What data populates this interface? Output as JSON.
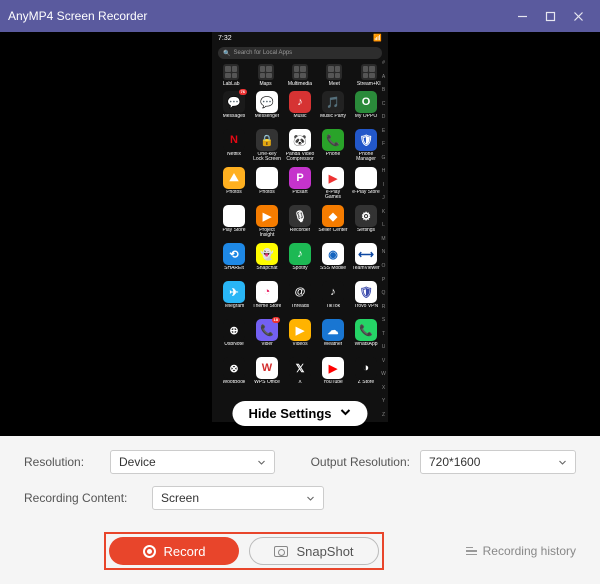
{
  "titlebar": {
    "title": "AnyMP4 Screen Recorder"
  },
  "phone": {
    "time": "7:32",
    "search_placeholder": "Search for Local Apps",
    "folders": [
      {
        "label": "LabLab"
      },
      {
        "label": "Maps"
      },
      {
        "label": "Multimedia"
      },
      {
        "label": "Meet"
      },
      {
        "label": "Stream+KI"
      }
    ],
    "apps": [
      {
        "label": "Messages",
        "bg": "#1a1a1a",
        "txt": "💬",
        "badge": "76"
      },
      {
        "label": "Messenger",
        "bg": "#fff",
        "txt": "💬"
      },
      {
        "label": "Music",
        "bg": "#d63333",
        "txt": "♪"
      },
      {
        "label": "Music Party",
        "bg": "#222",
        "txt": "🎵"
      },
      {
        "label": "My OPPO",
        "bg": "#2a8a3a",
        "txt": "O"
      },
      {
        "label": "Netflix",
        "bg": "#111",
        "txt": "N",
        "tc": "#e50914"
      },
      {
        "label": "One-key Lock Screen",
        "bg": "#333",
        "txt": "🔒"
      },
      {
        "label": "Panda Video Compressor",
        "bg": "#fff",
        "txt": "🐼"
      },
      {
        "label": "Phone",
        "bg": "#29a329",
        "txt": "📞"
      },
      {
        "label": "Phone Manager",
        "bg": "#2257c9",
        "txt": "🛡"
      },
      {
        "label": "Photos",
        "bg": "#ffb020",
        "txt": "⛰"
      },
      {
        "label": "Photos",
        "bg": "#fff",
        "txt": "✦"
      },
      {
        "label": "Picsart",
        "bg": "#c533cc",
        "txt": "P"
      },
      {
        "label": "e-Play Games",
        "bg": "#fff",
        "txt": "▶",
        "tc": "#e33"
      },
      {
        "label": "e-Play Store",
        "bg": "#fff",
        "txt": "▶"
      },
      {
        "label": "Play Store",
        "bg": "#fff",
        "txt": "▶"
      },
      {
        "label": "Project Insight",
        "bg": "#f57c00",
        "txt": "▶"
      },
      {
        "label": "Recorder",
        "bg": "#333",
        "txt": "🎙"
      },
      {
        "label": "Seller Center",
        "bg": "#f57c00",
        "txt": "◆"
      },
      {
        "label": "Settings",
        "bg": "#333",
        "txt": "⚙"
      },
      {
        "label": "SHAREit",
        "bg": "#1e88e5",
        "txt": "⟲"
      },
      {
        "label": "Snapchat",
        "bg": "#fffc00",
        "txt": "👻"
      },
      {
        "label": "Spotify",
        "bg": "#1db954",
        "txt": "♪"
      },
      {
        "label": "SSS Mobile",
        "bg": "#fff",
        "txt": "◉",
        "tc": "#1565c0"
      },
      {
        "label": "TeamViewer",
        "bg": "#fff",
        "txt": "⟷",
        "tc": "#0d47a1"
      },
      {
        "label": "Telegram",
        "bg": "#29b6f6",
        "txt": "✈"
      },
      {
        "label": "Theme Store",
        "bg": "#fff",
        "txt": "◔",
        "tc": "#e91e63"
      },
      {
        "label": "Threads",
        "bg": "#111",
        "txt": "@"
      },
      {
        "label": "TikTok",
        "bg": "#111",
        "txt": "♪"
      },
      {
        "label": "Trovo VPN",
        "bg": "#fff",
        "txt": "🛡",
        "tc": "#3949ab"
      },
      {
        "label": "UsbNote",
        "bg": "#111",
        "txt": "⊕"
      },
      {
        "label": "Viber",
        "bg": "#7360f2",
        "txt": "📞",
        "badge": "18"
      },
      {
        "label": "Videos",
        "bg": "#ffb300",
        "txt": "▶"
      },
      {
        "label": "Weather",
        "bg": "#1976d2",
        "txt": "☁"
      },
      {
        "label": "WhatsApp",
        "bg": "#25d366",
        "txt": "📞"
      },
      {
        "label": "WootBook",
        "bg": "#111",
        "txt": "⊗"
      },
      {
        "label": "WPS Office",
        "bg": "#fff",
        "txt": "W",
        "tc": "#d32f2f"
      },
      {
        "label": "X",
        "bg": "#111",
        "txt": "𝕏"
      },
      {
        "label": "YouTube",
        "bg": "#fff",
        "txt": "▶",
        "tc": "#ff0000"
      },
      {
        "label": "Z Store",
        "bg": "#111",
        "txt": "◑"
      }
    ],
    "index": [
      "#",
      "A",
      "B",
      "C",
      "D",
      "E",
      "F",
      "G",
      "H",
      "I",
      "J",
      "K",
      "L",
      "M",
      "N",
      "O",
      "P",
      "Q",
      "R",
      "S",
      "T",
      "U",
      "V",
      "W",
      "X",
      "Y",
      "Z"
    ]
  },
  "hide_settings": "Hide Settings",
  "settings": {
    "resolution_label": "Resolution:",
    "resolution_value": "Device",
    "output_label": "Output Resolution:",
    "output_value": "720*1600",
    "content_label": "Recording Content:",
    "content_value": "Screen"
  },
  "actions": {
    "record": "Record",
    "snapshot": "SnapShot",
    "history": "Recording history"
  }
}
